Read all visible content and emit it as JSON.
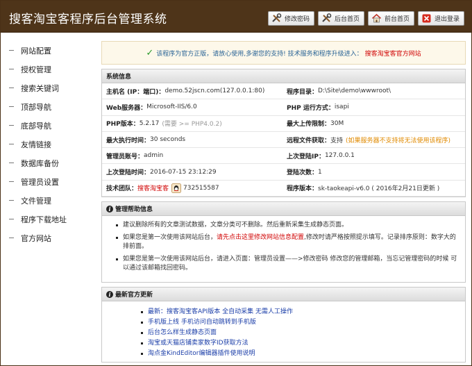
{
  "header": {
    "title": "搜客淘宝客程序后台管理系统",
    "buttons": [
      {
        "label": "修改密码",
        "icon": "tools-icon"
      },
      {
        "label": "后台首页",
        "icon": "tools-icon"
      },
      {
        "label": "前台首页",
        "icon": "home-icon"
      },
      {
        "label": "退出登录",
        "icon": "logout-icon"
      }
    ]
  },
  "sidebar": {
    "items": [
      "网站配置",
      "授权管理",
      "搜索关键词",
      "顶部导航",
      "底部导航",
      "友情链接",
      "数据库备份",
      "管理员设置",
      "文件管理",
      "程序下载地址",
      "官方网站"
    ]
  },
  "notice": {
    "text": "该程序为官方正版，请放心使用,多谢您的支持! 技术服务和程序升级进入：",
    "link": "搜客淘宝客官方网站"
  },
  "sysinfo": {
    "title": "系统信息",
    "host_k": "主机名 (IP：端口)：",
    "host_v": "demo.52jscn.com(127.0.0.1:80)",
    "dir_k": "程序目录：",
    "dir_v": "D:\\Site\\demo\\wwwroot\\",
    "web_k": "Web服务器：",
    "web_v": "Microsoft-IIS/6.0",
    "php_mode_k": "PHP 运行方式：",
    "php_mode_v": "isapi",
    "php_ver_k": "PHP版本：",
    "php_ver_v": "5.2.17",
    "php_ver_hint": "(需要 >= PHP4.0.2)",
    "upload_k": "最大上传限制：",
    "upload_v": "30M",
    "exec_k": "最大执行时间：",
    "exec_v": "30 seconds",
    "remote_k": "远程文件获取：",
    "remote_v": "支持",
    "remote_hint": "(如果服务器不支持将无法使用该程序)",
    "admin_k": "管理员账号：",
    "admin_v": "admin",
    "lastip_k": "上次登陆IP：",
    "lastip_v": "127.0.0.1",
    "lasttime_k": "上次登陆时间：",
    "lasttime_v": "2016-07-15 23:12:29",
    "count_k": "登陆次数：",
    "count_v": "1",
    "team_k": "技术团队：",
    "team_name": "搜客淘宝客",
    "team_qq": "732515587",
    "version_k": "程序版本：",
    "version_v": "sk-taokeapi-v6.0 ( 2016年2月21日更新 )"
  },
  "help": {
    "title": "管理帮助信息",
    "item1": "建议删除所有的文章测试数据，文章分类可不删除。然后重新采集生成静态页面。",
    "item2_pre": "如果您是第一次使用该网站后台，",
    "item2_red": "请先点击这里修改网站信息配置",
    "item2_post": ",修改时请严格按照提示填写。记录排序原则：数字大的排前面。",
    "item3": "如果您是第一次使用该网站后台，请进入页面：管理员设置——>修改密码 修改您的管理邮箱，当忘记管理密码的时候 可以通过该邮箱找回密码。"
  },
  "news": {
    "title": "最新官方更新",
    "items": [
      "最新：搜客淘宝客API版本 全自动采集 无需人工操作",
      "手机版上线 手机访问自动跳转到手机版",
      "后台怎么样生成静态页面",
      "淘宝或天猫店铺卖家数字ID获取方法",
      "淘点金KindEditor编辑器插件使用说明"
    ]
  },
  "colors": {
    "header_bg": "#4e3419",
    "accent_red": "#d00000",
    "link_blue": "#1a3da8",
    "warn_orange": "#e08a00"
  }
}
